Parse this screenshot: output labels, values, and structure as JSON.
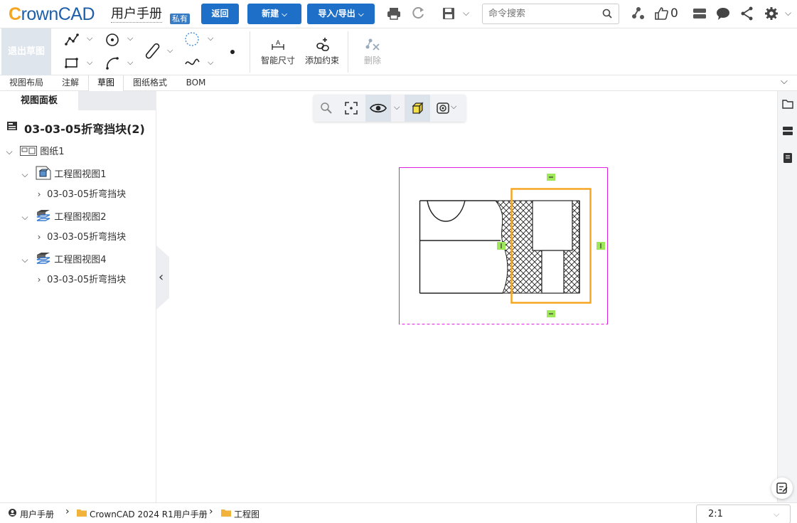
{
  "header": {
    "logo_text": "rownCAD",
    "logo_c": "C",
    "doc_title": "用户手册",
    "badge": "私有",
    "back_label": "返回",
    "new_label": "新建",
    "import_export_label": "导入/导出",
    "search_placeholder": "命令搜索",
    "likes": "0"
  },
  "ribbon": {
    "exit_sketch": "退出草图",
    "smart_dimension": "智能尺寸",
    "add_constraint": "添加约束",
    "delete": "删除"
  },
  "tabs": [
    {
      "label": "视图布局"
    },
    {
      "label": "注解"
    },
    {
      "label": "草图",
      "active": true
    },
    {
      "label": "图纸格式"
    },
    {
      "label": "BOM"
    }
  ],
  "panel": {
    "tab": "视图面板",
    "title": "03-03-05折弯挡块(2)",
    "tree": [
      {
        "label": "图纸1",
        "level": 0
      },
      {
        "label": "工程图视图1",
        "level": 1
      },
      {
        "label": "03-03-05折弯挡块",
        "level": 2
      },
      {
        "label": "工程图视图2",
        "level": 1
      },
      {
        "label": "03-03-05折弯挡块",
        "level": 2
      },
      {
        "label": "工程图视图4",
        "level": 1
      },
      {
        "label": "03-03-05折弯挡块",
        "level": 2
      }
    ]
  },
  "status": {
    "breadcrumb": [
      "用户手册",
      "CrownCAD 2024 R1用户手册",
      "工程图"
    ],
    "scale": "2:1"
  },
  "colors": {
    "accent": "#1e6fc8",
    "selection": "#f5a623",
    "view_border": "#e020e0",
    "handle": "#9ee65a"
  }
}
